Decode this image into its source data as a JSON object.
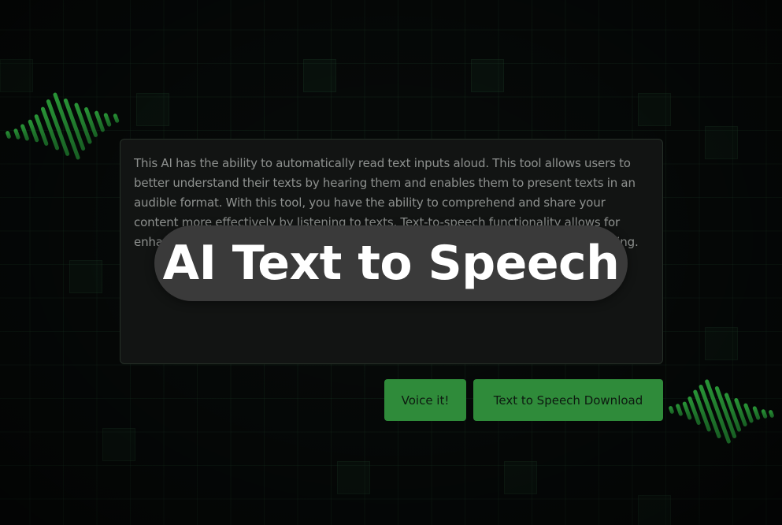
{
  "editor": {
    "text": "This AI has the ability to automatically read text inputs aloud. This tool allows users to better understand their texts by hearing them and enables them to present texts in an audible format. With this tool, you have the ability to comprehend and share your content more effectively by listening to texts. Text-to-speech functionality allows for enhanced proofreading and verification of texts, aiding in error detection and meaning."
  },
  "overlay": {
    "title": "AI Text to Speech"
  },
  "actions": {
    "voice_label": "Voice it!",
    "download_label": "Text to Speech Download"
  },
  "colors": {
    "accent": "#2f8b3a",
    "wave": "#2fae3f",
    "background": "#050806",
    "pill": "#3a3a3a"
  }
}
